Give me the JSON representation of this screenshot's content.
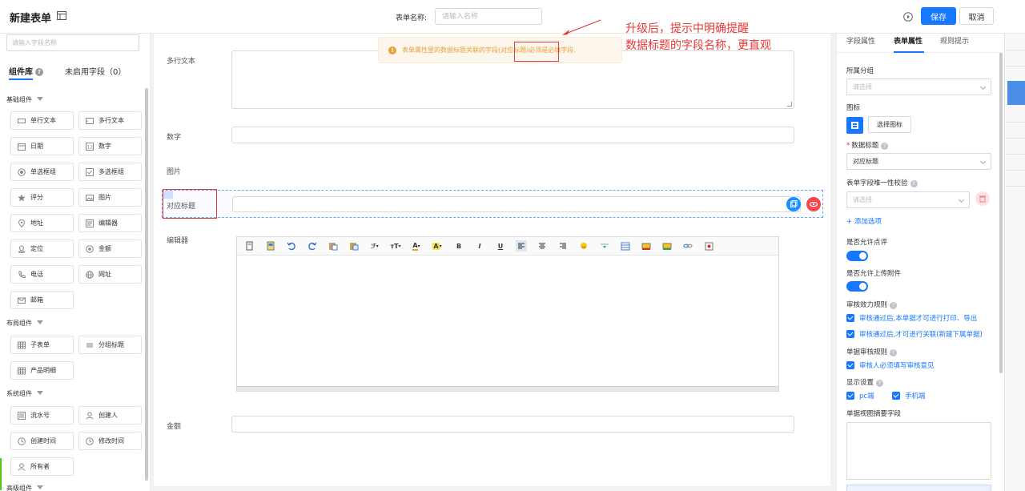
{
  "header": {
    "page_title": "新建表单",
    "form_name_label": "表单名称:",
    "form_name_placeholder": "请输入名称",
    "save_label": "保存",
    "cancel_label": "取消"
  },
  "left_panel": {
    "search_placeholder": "请输入字段名称",
    "tabs": {
      "library": "组件库",
      "unused": "未启用字段（0）"
    },
    "groups": {
      "basic": {
        "title": "基础组件",
        "items": [
          "单行文本",
          "多行文本",
          "日期",
          "数字",
          "单选框组",
          "多选框组",
          "评分",
          "图片",
          "地址",
          "编辑器",
          "定位",
          "金额",
          "电话",
          "网址",
          "邮箱"
        ]
      },
      "layout": {
        "title": "布局组件",
        "items": [
          "子表单",
          "分组标题",
          "产品明细"
        ]
      },
      "system": {
        "title": "系统组件",
        "items": [
          "流水号",
          "创建人",
          "创建时间",
          "修改时间",
          "所有者"
        ]
      },
      "advanced": {
        "title": "高级组件"
      }
    }
  },
  "canvas": {
    "fields": {
      "multiline": "多行文本",
      "number": "数字",
      "image": "图片",
      "selected": "对应标题",
      "editor": "编辑器",
      "amount": "金额"
    }
  },
  "alert": {
    "text_before": "表单属性里的数据标题关联的字段",
    "highlight": "(对应标题)",
    "text_after": "必须是必填字段."
  },
  "annotation": {
    "line1": "升级后，提示中明确提醒",
    "line2": "数据标题的字段名称，更直观"
  },
  "right_panel": {
    "tabs": {
      "field_props": "字段属性",
      "form_props": "表单属性",
      "rule_hints": "规则提示"
    },
    "group_label": "所属分组",
    "group_placeholder": "请选择",
    "icon_label": "图标",
    "choose_icon": "选择图标",
    "data_title_label": "数据标题",
    "data_title_value": "对应标题",
    "unique_check_label": "表单字段唯一性校验",
    "unique_check_placeholder": "请选择",
    "add_option": "+ 添加选项",
    "allow_comment_label": "是否允许点评",
    "allow_attachment_label": "是否允许上传附件",
    "audit_rule_label": "审核效力规则",
    "audit_rule_opt1": "审核通过后,本单据才可进行打印、导出",
    "audit_rule_opt2": "审核通过后,才可进行关联(新建下属单据)",
    "doc_audit_label": "单据审核规则",
    "doc_audit_opt1": "审核人必须填写审核意见",
    "display_label": "显示设置",
    "display_pc": "pc端",
    "display_mobile": "手机端",
    "summary_label": "单据视图摘要字段"
  },
  "colors": {
    "accent": "#1677ff",
    "danger": "#e53935",
    "warning": "#e6a23c"
  }
}
